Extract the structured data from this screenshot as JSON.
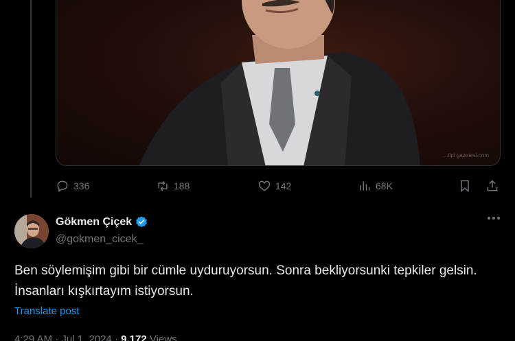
{
  "quoted_tweet": {
    "media_caption": "…lipi gazetesi.com",
    "actions": {
      "replies": "336",
      "retweets": "188",
      "likes": "142",
      "views": "68K"
    }
  },
  "reply_tweet": {
    "author_name": "Gökmen Çiçek",
    "author_handle": "@gokmen_cicek_",
    "verified": true,
    "text": "Ben söylemişim gibi bir cümle uyduruyorsun. Sonra bekliyorsunki tepkiler gelsin. İnsanları kışkırtayım istiyorsun.",
    "translate_label": "Translate post",
    "time": "4:29 AM",
    "date": "Jul 1, 2024",
    "views_count": "9,172",
    "views_label": "Views"
  },
  "colors": {
    "background": "#000000",
    "text_primary": "#e7e9ea",
    "text_secondary": "#71767b",
    "accent": "#1d9bf0"
  },
  "icons": [
    "reply-icon",
    "retweet-icon",
    "like-icon",
    "views-icon",
    "bookmark-icon",
    "share-icon",
    "verified-icon",
    "more-icon"
  ]
}
